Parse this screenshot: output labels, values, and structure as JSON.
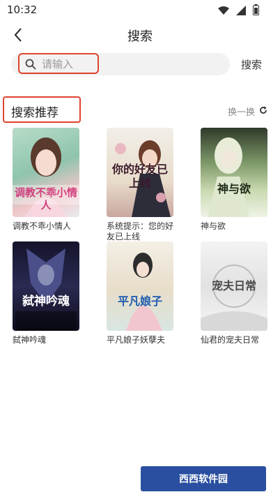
{
  "status_bar": {
    "time": "10:32",
    "icons": [
      "wifi-icon",
      "signal-icon",
      "battery-icon"
    ]
  },
  "header": {
    "title": "搜索",
    "back_icon": "back-arrow-icon"
  },
  "search": {
    "placeholder": "请输入",
    "action_label": "搜索"
  },
  "recommend": {
    "title": "搜索推荐",
    "refresh_label": "换一换",
    "books": [
      {
        "title": "调教不乖小情人",
        "cover_text": "调教不乖小情人",
        "accent": "#7fb6a3"
      },
      {
        "title": "系统提示：您的好友已上线",
        "cover_text": "你的好友已上线",
        "accent": "#e3dcc8"
      },
      {
        "title": "神与欲",
        "cover_text": "神与欲",
        "accent": "#9bb08a"
      },
      {
        "title": "弑神吟魂",
        "cover_text": "弑神吟魂",
        "accent": "#1d1e3a"
      },
      {
        "title": "平凡娘子妖孽夫",
        "cover_text": "平凡娘子",
        "accent": "#e9e1d2"
      },
      {
        "title": "仙君的宠夫日常",
        "cover_text": "宠夫日常",
        "accent": "#ececec"
      }
    ]
  },
  "watermark": {
    "text": "西西软件园"
  },
  "colors": {
    "highlight": "#e0432f",
    "search_bg": "#f2f2f2"
  }
}
